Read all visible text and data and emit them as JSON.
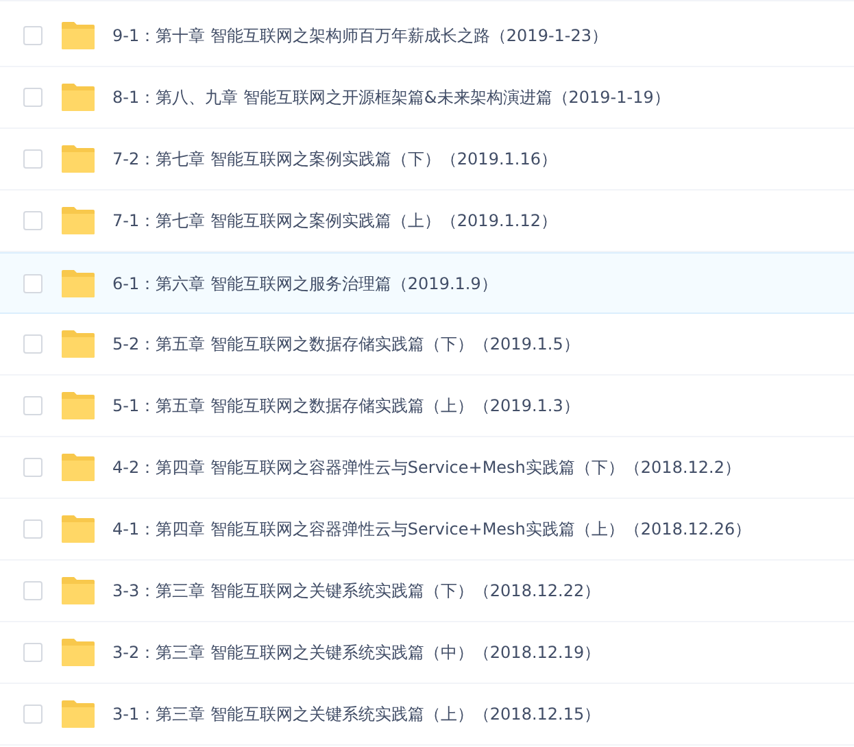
{
  "files": [
    {
      "name": "9-1：第十章 智能互联网之架构师百万年薪成长之路（2019-1-23）",
      "checked": false,
      "highlighted": false
    },
    {
      "name": "8-1：第八、九章 智能互联网之开源框架篇&未来架构演进篇（2019-1-19）",
      "checked": false,
      "highlighted": false
    },
    {
      "name": "7-2：第七章 智能互联网之案例实践篇（下）（2019.1.16）",
      "checked": false,
      "highlighted": false
    },
    {
      "name": "7-1：第七章 智能互联网之案例实践篇（上）（2019.1.12）",
      "checked": false,
      "highlighted": false
    },
    {
      "name": "6-1：第六章 智能互联网之服务治理篇（2019.1.9）",
      "checked": false,
      "highlighted": true
    },
    {
      "name": "5-2：第五章 智能互联网之数据存储实践篇（下）（2019.1.5）",
      "checked": false,
      "highlighted": false
    },
    {
      "name": "5-1：第五章 智能互联网之数据存储实践篇（上）（2019.1.3）",
      "checked": false,
      "highlighted": false
    },
    {
      "name": "4-2：第四章 智能互联网之容器弹性云与Service+Mesh实践篇（下）（2018.12.2）",
      "checked": false,
      "highlighted": false
    },
    {
      "name": "4-1：第四章 智能互联网之容器弹性云与Service+Mesh实践篇（上）（2018.12.26）",
      "checked": false,
      "highlighted": false
    },
    {
      "name": "3-3：第三章 智能互联网之关键系统实践篇（下）（2018.12.22）",
      "checked": false,
      "highlighted": false
    },
    {
      "name": "3-2：第三章 智能互联网之关键系统实践篇（中）（2018.12.19）",
      "checked": false,
      "highlighted": false
    },
    {
      "name": "3-1：第三章 智能互联网之关键系统实践篇（上）（2018.12.15）",
      "checked": false,
      "highlighted": false
    }
  ]
}
